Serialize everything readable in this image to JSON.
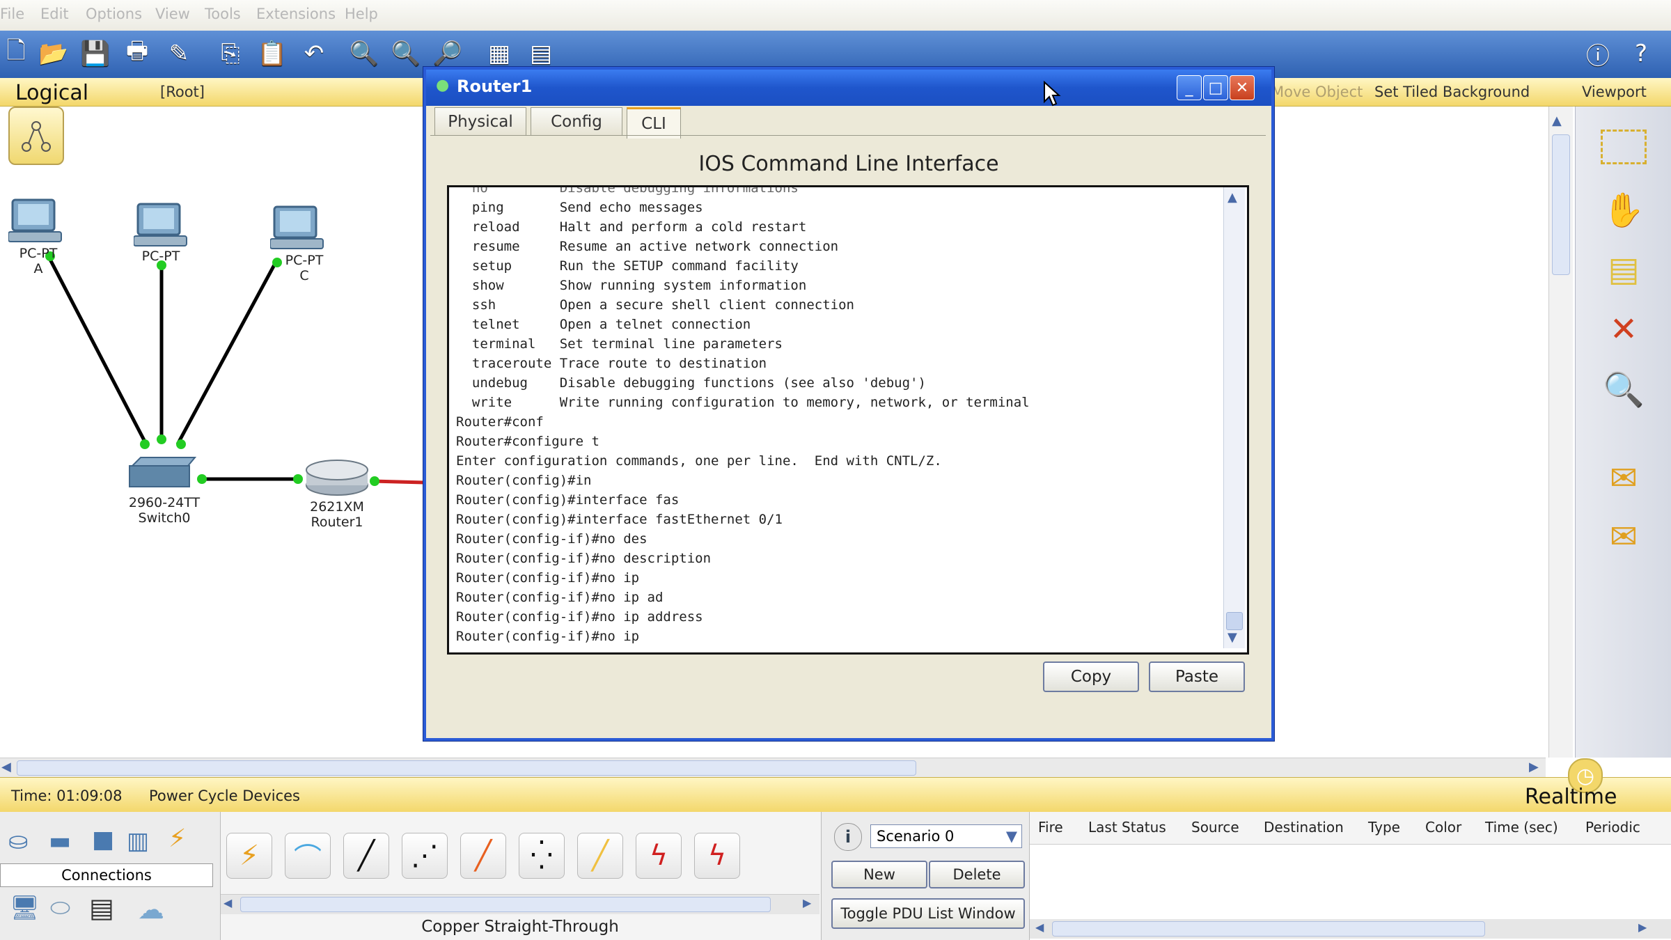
{
  "menu": [
    "File",
    "Edit",
    "Options",
    "View",
    "Tools",
    "Extensions",
    "Help"
  ],
  "logical_bar": {
    "mode": "Logical",
    "root": "[Root]",
    "move_object": "Move Object",
    "set_tiled": "Set Tiled Background",
    "viewport": "Viewport"
  },
  "devices": {
    "pc_a": {
      "name_line1": "PC-PT",
      "name_line2": "A"
    },
    "pc_b": {
      "name_line1": "PC-PT",
      "name_line2": ""
    },
    "pc_c": {
      "name_line1": "PC-PT",
      "name_line2": "C"
    },
    "switch": {
      "model": "2960-24TT",
      "name": "Switch0"
    },
    "router": {
      "model": "2621XM",
      "name": "Router1"
    }
  },
  "dialog": {
    "title": "Router1",
    "tabs": [
      "Physical",
      "Config",
      "CLI"
    ],
    "active_tab": "CLI",
    "heading": "IOS Command Line Interface",
    "cli_lines": [
      "  no         Disable debugging informations",
      "  ping       Send echo messages",
      "  reload     Halt and perform a cold restart",
      "  resume     Resume an active network connection",
      "  setup      Run the SETUP command facility",
      "  show       Show running system information",
      "  ssh        Open a secure shell client connection",
      "  telnet     Open a telnet connection",
      "  terminal   Set terminal line parameters",
      "  traceroute Trace route to destination",
      "  undebug    Disable debugging functions (see also 'debug')",
      "  write      Write running configuration to memory, network, or terminal",
      "Router#conf",
      "Router#configure t",
      "Enter configuration commands, one per line.  End with CNTL/Z.",
      "Router(config)#in",
      "Router(config)#interface fas",
      "Router(config)#interface fastEthernet 0/1",
      "Router(config-if)#no des",
      "Router(config-if)#no description",
      "Router(config-if)#no ip",
      "Router(config-if)#no ip ad",
      "Router(config-if)#no ip address",
      "Router(config-if)#no ip"
    ],
    "copy_label": "Copy",
    "paste_label": "Paste"
  },
  "status": {
    "time": "Time: 01:09:08",
    "power_cycle": "Power Cycle Devices",
    "mode": "Realtime"
  },
  "bottom": {
    "connections_label": "Connections",
    "selected_connection": "Copper Straight-Through",
    "scenario": "Scenario 0",
    "new_label": "New",
    "delete_label": "Delete",
    "toggle_label": "Toggle PDU List Window",
    "pdu_columns": [
      "Fire",
      "Last Status",
      "Source",
      "Destination",
      "Type",
      "Color",
      "Time (sec)",
      "Periodic"
    ]
  },
  "colors": {
    "accent": "#2a5bd6",
    "status_bar": "#f3d76a",
    "link_up": "#22cc22",
    "link_down": "#cc2222"
  }
}
